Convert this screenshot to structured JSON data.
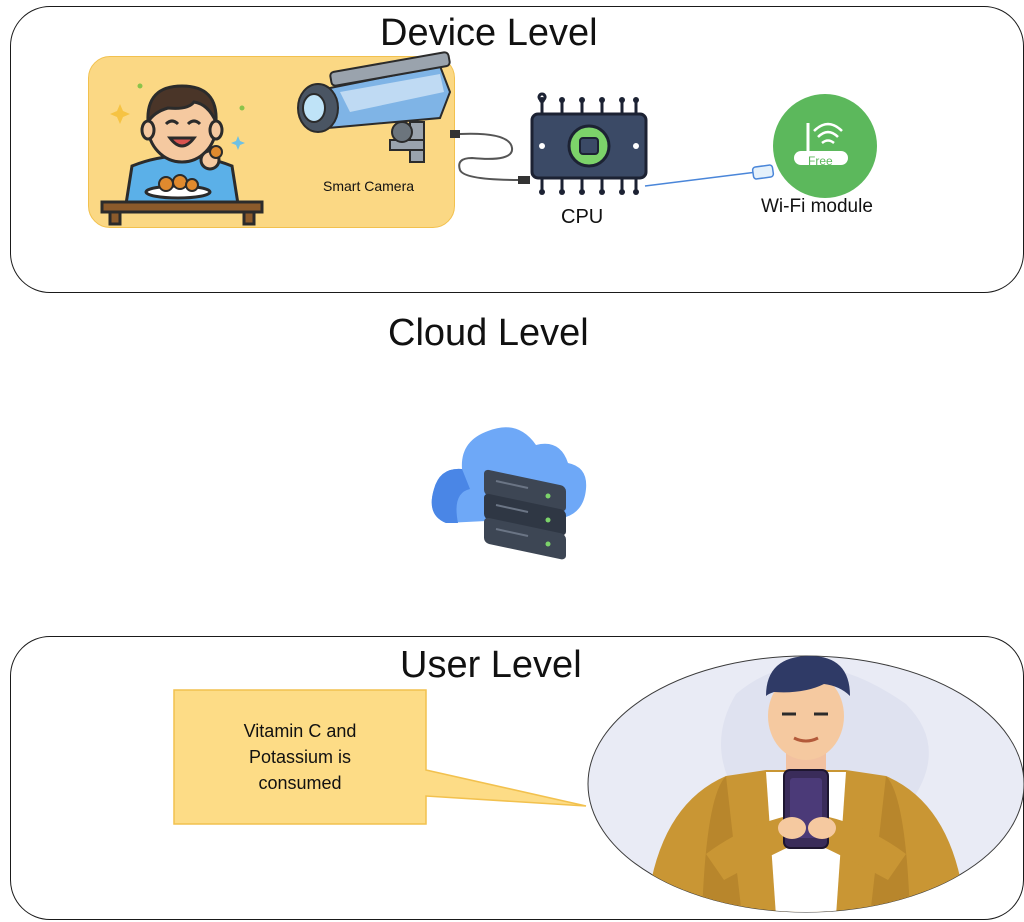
{
  "device_level": {
    "title": "Device Level",
    "camera_label": "Smart Camera",
    "cpu_label": "CPU",
    "wifi_label": "Wi-Fi module",
    "wifi_badge": "Free"
  },
  "cloud_level": {
    "title": "Cloud Level"
  },
  "user_level": {
    "title": "User Level",
    "notification_line1": "Vitamin C and",
    "notification_line2": "Potassium is",
    "notification_line3": "consumed"
  },
  "colors": {
    "camera_box_fill": "#fbd884",
    "callout_fill": "#fddc86",
    "wifi_green": "#5cb85c",
    "cloud_blue": "#6ea8f7",
    "server_dark": "#3d4654",
    "jacket": "#c99634"
  }
}
